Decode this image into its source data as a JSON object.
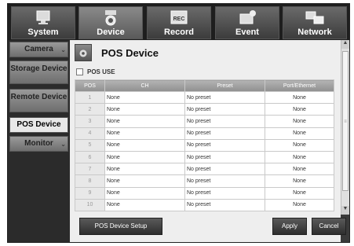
{
  "topnav": {
    "tabs": [
      {
        "label": "System",
        "icon": "monitor-icon"
      },
      {
        "label": "Device",
        "icon": "camera-icon"
      },
      {
        "label": "Record",
        "icon": "rec-icon",
        "badge": "REC"
      },
      {
        "label": "Event",
        "icon": "event-icon"
      },
      {
        "label": "Network",
        "icon": "network-icon"
      }
    ],
    "active": "Device"
  },
  "sidebar": {
    "items": [
      {
        "label": "Camera"
      },
      {
        "label": "Storage Device"
      },
      {
        "label": "Remote Device"
      },
      {
        "label": "POS Device"
      },
      {
        "label": "Monitor"
      }
    ],
    "active": "POS Device"
  },
  "main": {
    "title": "POS Device",
    "pos_use_label": "POS USE",
    "pos_use_checked": false,
    "columns": [
      "POS",
      "CH",
      "Preset",
      "Port/Ethernet"
    ],
    "rows": [
      [
        "1",
        "None",
        "No preset",
        "None"
      ],
      [
        "2",
        "None",
        "No preset",
        "None"
      ],
      [
        "3",
        "None",
        "No preset",
        "None"
      ],
      [
        "4",
        "None",
        "No preset",
        "None"
      ],
      [
        "5",
        "None",
        "No preset",
        "None"
      ],
      [
        "6",
        "None",
        "No preset",
        "None"
      ],
      [
        "7",
        "None",
        "No preset",
        "None"
      ],
      [
        "8",
        "None",
        "No preset",
        "None"
      ],
      [
        "9",
        "None",
        "No preset",
        "None"
      ],
      [
        "10",
        "None",
        "No preset",
        "None"
      ]
    ]
  },
  "buttons": {
    "setup": "POS Device Setup",
    "apply": "Apply",
    "cancel": "Cancel"
  },
  "scrollbar": {
    "up": "▲",
    "down": "▼",
    "grip": "≡"
  },
  "colors": {
    "nav_bg": "#1e1e1e",
    "content_bg": "#eeeeee",
    "header_row": "#a0a0a0"
  }
}
